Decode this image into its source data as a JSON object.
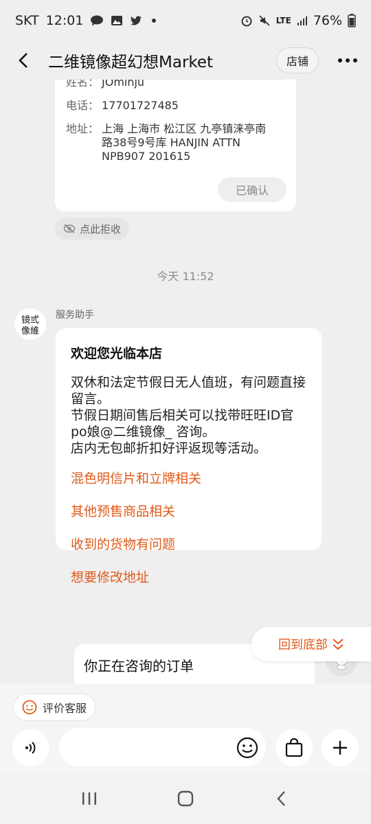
{
  "status_bar": {
    "carrier": "SKT",
    "time": "12:01",
    "network": "LTE",
    "battery": "76%"
  },
  "header": {
    "title": "二维镜像超幻想Market",
    "store_label": "店铺"
  },
  "address_card": {
    "name_label": "姓名：",
    "name_value": "JOminju",
    "phone_label": "电话：",
    "phone_value": "17701727485",
    "address_label": "地址：",
    "address_value": "上海 上海市 松江区 九亭镇涞亭南路38号9号库 HANJIN ATTN NPB907 201615",
    "confirm_label": "已确认"
  },
  "reject_label": "点此拒收",
  "timestamp": "今天  11:52",
  "message": {
    "sender": "服务助手",
    "title": "欢迎您光临本店",
    "body": "双休和法定节假日无人值班，有问题直接留言。\n节假日期间售后相关可以找带旺旺ID官po娘@二维镜像_ 咨询。\n店内无包邮折扣好评返现等活动。",
    "links": [
      "混色明信片和立牌相关",
      "其他预售商品相关",
      "收到的货物有问题",
      "想要修改地址"
    ]
  },
  "back_to_bottom": "回到底部",
  "order_card": {
    "title": "你正在咨询的订单"
  },
  "bottom": {
    "rate_label": "评价客服",
    "input_placeholder": ""
  },
  "colors": {
    "accent": "#e05a1a",
    "background": "#efefef"
  }
}
